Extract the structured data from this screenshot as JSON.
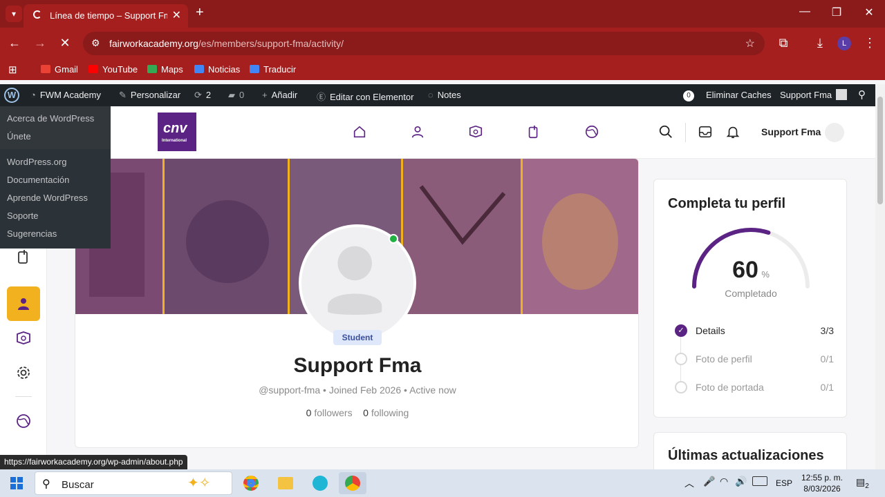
{
  "browser": {
    "tab_title": "Línea de tiempo – Support Fma",
    "url_host": "fairworkacademy.org",
    "url_path": "/es/members/support-fma/activity/",
    "profile_initial": "L",
    "bookmarks": [
      {
        "label": "Gmail",
        "color": "#ea4335"
      },
      {
        "label": "YouTube",
        "color": "#ff0000"
      },
      {
        "label": "Maps",
        "color": "#34a853"
      },
      {
        "label": "Noticias",
        "color": "#4285f4"
      },
      {
        "label": "Traducir",
        "color": "#4285f4"
      }
    ]
  },
  "wp_admin": {
    "site_name": "FWM Academy",
    "customize": "Personalizar",
    "updates_count": "2",
    "comments_count": "0",
    "add_new": "Añadir",
    "elementor": "Editar con Elementor",
    "notes": "Notes",
    "cache_count": "0",
    "clear_cache": "Eliminar Caches",
    "user": "Support Fma",
    "dropdown_group1": [
      "Acerca de WordPress",
      "Únete"
    ],
    "dropdown_group2": [
      "WordPress.org",
      "Documentación",
      "Aprende WordPress",
      "Soporte",
      "Sugerencias"
    ]
  },
  "site": {
    "logo_text": "cnv",
    "logo_sub": "International",
    "header_user": "Support Fma"
  },
  "profile": {
    "badge": "Student",
    "name": "Support Fma",
    "handle": "@support-fma",
    "joined": "Joined Feb 2026",
    "activity": "Active now",
    "followers_count": "0",
    "followers_label": "followers",
    "following_count": "0",
    "following_label": "following"
  },
  "complete_profile": {
    "title": "Completa tu perfil",
    "percent": "60",
    "percent_sign": "%",
    "progress_value": 60,
    "completed_label": "Completado",
    "steps": [
      {
        "label": "Details",
        "count": "3/3",
        "done": true
      },
      {
        "label": "Foto de perfil",
        "count": "0/1",
        "done": false
      },
      {
        "label": "Foto de portada",
        "count": "0/1",
        "done": false
      }
    ],
    "accent_color": "#5b2383"
  },
  "updates": {
    "title": "Últimas actualizaciones"
  },
  "status_url": "https://fairworkacademy.org/wp-admin/about.php",
  "taskbar": {
    "search_placeholder": "Buscar",
    "lang": "ESP",
    "time": "12:55 p. m.",
    "date": "8/03/2026",
    "notifications": "2"
  }
}
